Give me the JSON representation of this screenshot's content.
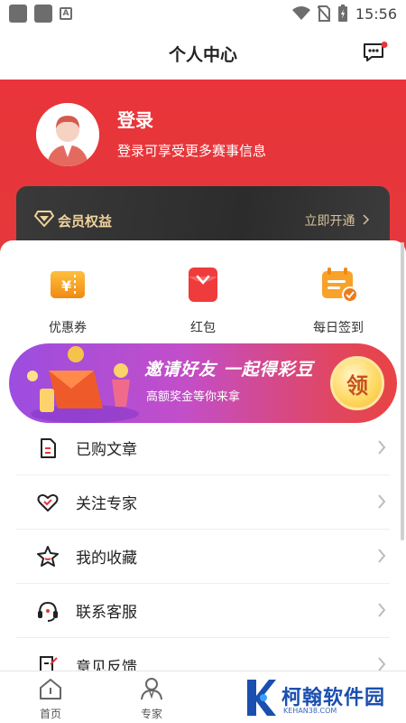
{
  "status_bar": {
    "time": "15:56"
  },
  "header": {
    "title": "个人中心"
  },
  "profile": {
    "login_title": "登录",
    "login_subtitle": "登录可享受更多赛事信息"
  },
  "vip": {
    "label": "会员权益",
    "open_label": "立即开通",
    "accent_color": "#f0d39c"
  },
  "quick_actions": [
    {
      "label": "优惠券",
      "icon": "coupon-icon"
    },
    {
      "label": "红包",
      "icon": "red-packet-icon"
    },
    {
      "label": "每日签到",
      "icon": "calendar-checkin-icon"
    }
  ],
  "banner": {
    "title": "邀请好友  一起得彩豆",
    "subtitle": "高额奖金等你来拿",
    "button": "领"
  },
  "menu": [
    {
      "label": "已购文章",
      "icon": "document-icon"
    },
    {
      "label": "关注专家",
      "icon": "heart-icon"
    },
    {
      "label": "我的收藏",
      "icon": "star-icon"
    },
    {
      "label": "联系客服",
      "icon": "headset-icon"
    },
    {
      "label": "意见反馈",
      "icon": "feedback-icon"
    }
  ],
  "tabbar": [
    {
      "label": "首页",
      "icon": "home-icon"
    },
    {
      "label": "专家",
      "icon": "expert-icon"
    }
  ],
  "watermark": {
    "brand": "柯翰软件园",
    "url": "KEHAN38.COM"
  },
  "colors": {
    "brand_red": "#e8343a",
    "gold": "#f6b73c"
  }
}
